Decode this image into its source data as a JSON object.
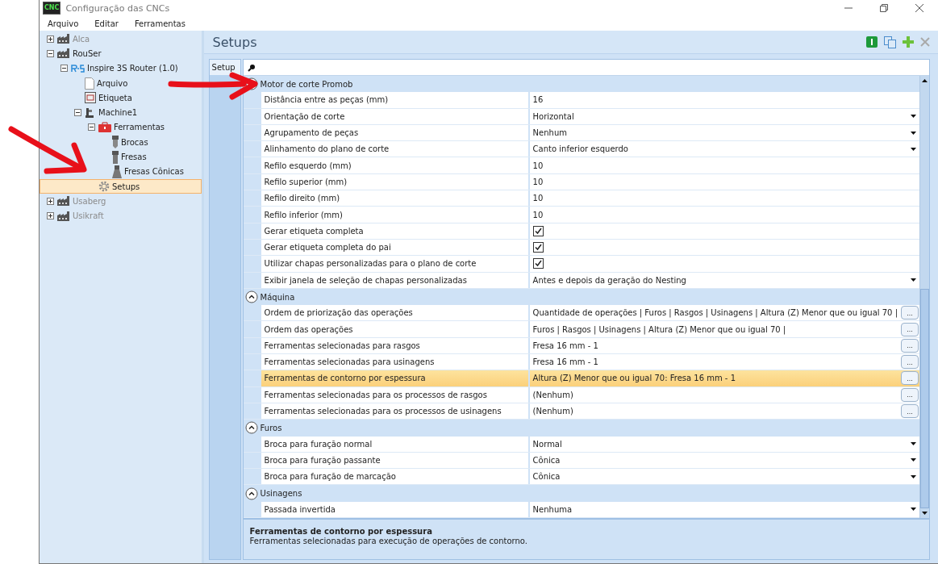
{
  "window": {
    "logo_text": "CNC",
    "title": "Configuração das CNCs"
  },
  "menu": [
    "Arquivo",
    "Editar",
    "Ferramentas"
  ],
  "tree": [
    {
      "label": "Alca",
      "kind": "factory",
      "expanded": false,
      "disabled": true,
      "selected": false
    },
    {
      "label": "RouSer",
      "kind": "factory",
      "expanded": true,
      "disabled": false,
      "selected": false,
      "children": [
        {
          "label": "Inspire 3S Router (1.0)",
          "kind": "router",
          "expanded": true,
          "disabled": false,
          "selected": false,
          "children": [
            {
              "label": "Arquivo",
              "kind": "file",
              "disabled": false,
              "selected": false
            },
            {
              "label": "Etiqueta",
              "kind": "label",
              "disabled": false,
              "selected": false
            },
            {
              "label": "Machine1",
              "kind": "machine",
              "expanded": true,
              "disabled": false,
              "selected": false,
              "children": [
                {
                  "label": "Ferramentas",
                  "kind": "toolbox",
                  "expanded": true,
                  "disabled": false,
                  "selected": false,
                  "children": [
                    {
                      "label": "Brocas",
                      "kind": "drill",
                      "disabled": false,
                      "selected": false
                    },
                    {
                      "label": "Fresas",
                      "kind": "mill",
                      "disabled": false,
                      "selected": false
                    },
                    {
                      "label": "Fresas Cônicas",
                      "kind": "conical",
                      "disabled": false,
                      "selected": false
                    }
                  ]
                },
                {
                  "label": "Setups",
                  "kind": "gear",
                  "disabled": false,
                  "selected": true
                }
              ]
            }
          ]
        }
      ]
    },
    {
      "label": "Usaberg",
      "kind": "factory",
      "expanded": false,
      "disabled": true,
      "selected": false
    },
    {
      "label": "Usikraft",
      "kind": "factory",
      "expanded": false,
      "disabled": true,
      "selected": false
    }
  ],
  "panel": {
    "title": "Setups",
    "tab": "Setup"
  },
  "categories": [
    {
      "name": "Motor de corte Promob",
      "expanded": true,
      "rows": [
        {
          "name": "Distância entre as peças (mm)",
          "value": "16",
          "kind": "text",
          "selected": false
        },
        {
          "name": "Orientação de corte",
          "value": "Horizontal",
          "kind": "dropdown",
          "selected": false
        },
        {
          "name": "Agrupamento de peças",
          "value": "Nenhum",
          "kind": "dropdown",
          "selected": false
        },
        {
          "name": "Alinhamento do plano de corte",
          "value": "Canto inferior esquerdo",
          "kind": "dropdown",
          "selected": false
        },
        {
          "name": "Refilo esquerdo (mm)",
          "value": "10",
          "kind": "text",
          "selected": false
        },
        {
          "name": "Refilo superior (mm)",
          "value": "10",
          "kind": "text",
          "selected": false
        },
        {
          "name": "Refilo direito (mm)",
          "value": "10",
          "kind": "text",
          "selected": false
        },
        {
          "name": "Refilo inferior (mm)",
          "value": "10",
          "kind": "text",
          "selected": false
        },
        {
          "name": "Gerar etiqueta completa",
          "kind": "checkbox",
          "checked": true,
          "selected": false
        },
        {
          "name": "Gerar etiqueta completa do pai",
          "kind": "checkbox",
          "checked": true,
          "selected": false
        },
        {
          "name": "Utilizar chapas personalizadas para o plano de corte",
          "kind": "checkbox",
          "checked": true,
          "selected": false
        },
        {
          "name": "Exibir janela de seleção de chapas personalizadas",
          "value": "Antes e depois da geração do Nesting",
          "kind": "dropdown",
          "selected": false
        }
      ]
    },
    {
      "name": "Máquina",
      "expanded": true,
      "rows": [
        {
          "name": "Ordem de priorização das operações",
          "value": "Quantidade de operações | Furos | Rasgos | Usinagens | Altura (Z) Menor que ou igual 70 |",
          "kind": "ellipsis",
          "button": "...",
          "selected": false
        },
        {
          "name": "Ordem das operações",
          "value": "Furos | Rasgos | Usinagens | Altura (Z) Menor que ou igual 70 |",
          "kind": "ellipsis",
          "button": "...",
          "selected": false
        },
        {
          "name": "Ferramentas selecionadas para rasgos",
          "value": "Fresa 16 mm - 1",
          "kind": "ellipsis",
          "button": "...",
          "selected": false
        },
        {
          "name": "Ferramentas selecionadas para usinagens",
          "value": "Fresa 16 mm - 1",
          "kind": "ellipsis",
          "button": "...",
          "selected": false
        },
        {
          "name": "Ferramentas de contorno por espessura",
          "value": "Altura (Z) Menor que ou igual 70: Fresa 16 mm - 1",
          "kind": "ellipsis",
          "button": "...",
          "selected": true
        },
        {
          "name": "Ferramentas selecionadas para os processos de rasgos",
          "value": "(Nenhum)",
          "kind": "ellipsis",
          "button": "...",
          "selected": false
        },
        {
          "name": "Ferramentas selecionadas para os processos de usinagens",
          "value": "(Nenhum)",
          "kind": "ellipsis",
          "button": "...",
          "selected": false
        }
      ]
    },
    {
      "name": "Furos",
      "expanded": true,
      "rows": [
        {
          "name": "Broca para furação normal",
          "value": "Normal",
          "kind": "dropdown",
          "selected": false
        },
        {
          "name": "Broca para furação passante",
          "value": "Cônica",
          "kind": "dropdown",
          "selected": false
        },
        {
          "name": "Broca para furação de marcação",
          "value": "Cônica",
          "kind": "dropdown",
          "selected": false
        }
      ]
    },
    {
      "name": "Usinagens",
      "expanded": true,
      "rows": [
        {
          "name": "Passada invertida",
          "value": "Nenhuma",
          "kind": "dropdown",
          "selected": false
        }
      ]
    }
  ],
  "description": {
    "title": "Ferramentas de contorno por espessura",
    "text": "Ferramentas selecionadas para execução de operações de contorno."
  }
}
